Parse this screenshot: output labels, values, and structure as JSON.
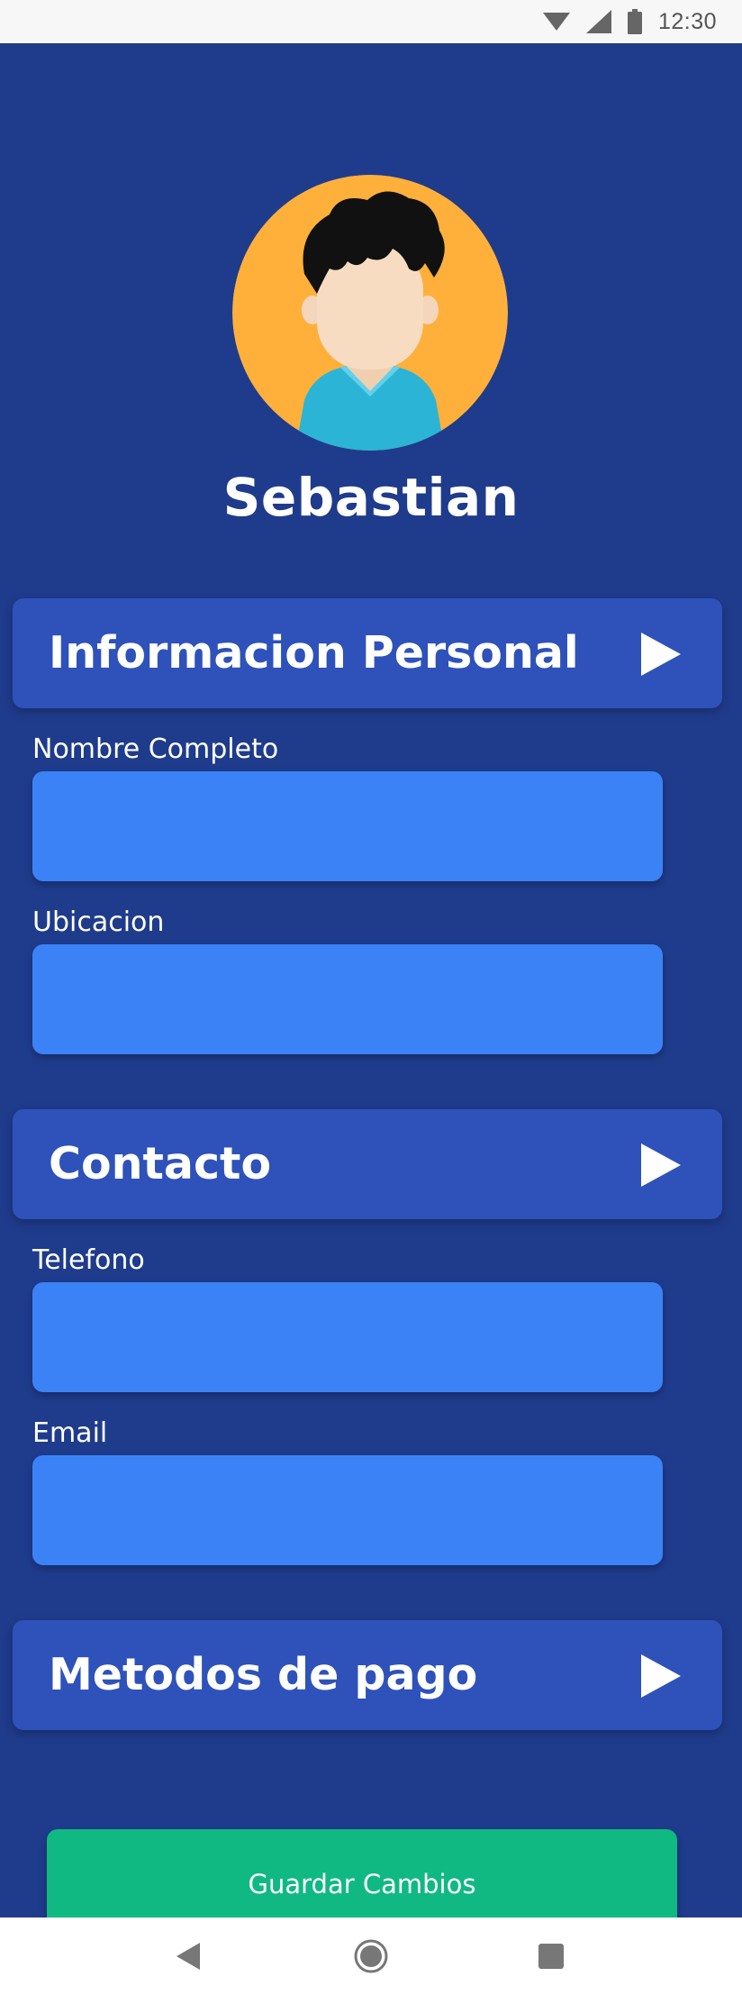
{
  "status_bar": {
    "time": "12:30",
    "icons": [
      "wifi-icon",
      "signal-icon",
      "battery-icon"
    ]
  },
  "profile": {
    "name": "Sebastian",
    "avatar": "avatar-illustration"
  },
  "sections": {
    "personal": {
      "title": "Informacion Personal",
      "icon": "play-arrow-icon",
      "fields": {
        "full_name": {
          "label": "Nombre Completo",
          "value": "",
          "placeholder": ""
        },
        "location": {
          "label": "Ubicacion",
          "value": "",
          "placeholder": ""
        }
      }
    },
    "contact": {
      "title": "Contacto",
      "icon": "play-arrow-icon",
      "fields": {
        "phone": {
          "label": "Telefono",
          "value": "",
          "placeholder": ""
        },
        "email": {
          "label": "Email",
          "value": "",
          "placeholder": ""
        }
      }
    },
    "payment": {
      "title": "Metodos de pago",
      "icon": "play-arrow-icon"
    }
  },
  "actions": {
    "save_label": "Guardar Cambios"
  },
  "nav_bar": {
    "icons": [
      "back-icon",
      "home-icon",
      "recents-icon"
    ]
  },
  "colors": {
    "background": "#1f3b8c",
    "section_header": "#2e52ba",
    "input": "#3b82f6",
    "save_button": "#10b981",
    "avatar_bg": "#ffb03b"
  }
}
